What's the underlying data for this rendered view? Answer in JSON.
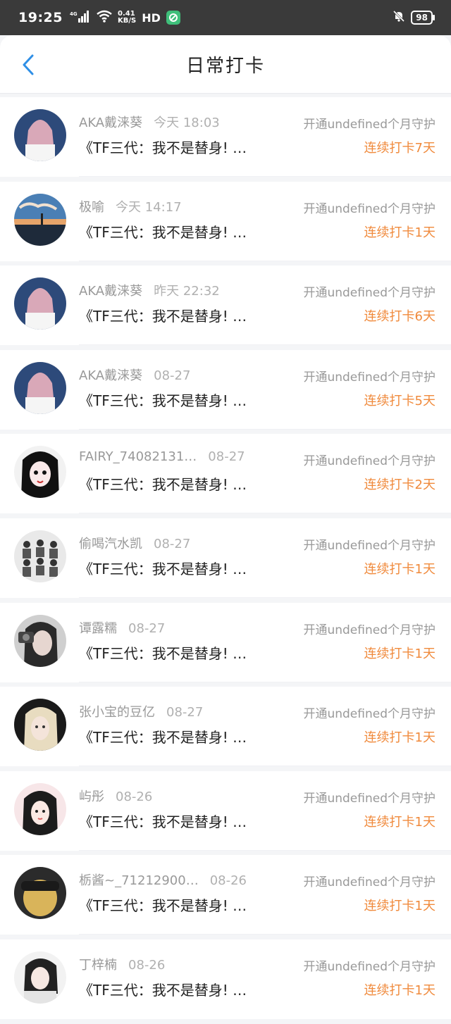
{
  "status_bar": {
    "time": "19:25",
    "network": "4G",
    "speed_top": "0.41",
    "speed_bottom": "KB/S",
    "hd": "HD",
    "battery": "98"
  },
  "header": {
    "title": "日常打卡"
  },
  "colors": {
    "accent": "#f08a3c",
    "back": "#2f8fe6"
  },
  "rows": [
    {
      "name": "AKA戴涞葵",
      "time": "今天 18:03",
      "title": "《TF三代：我不是替身! …",
      "right_top": "开通undefined个月守护",
      "right_bottom": "连续打卡7天"
    },
    {
      "name": "极喻",
      "time": "今天 14:17",
      "title": "《TF三代：我不是替身! …",
      "right_top": "开通undefined个月守护",
      "right_bottom": "连续打卡1天"
    },
    {
      "name": "AKA戴涞葵",
      "time": "昨天 22:32",
      "title": "《TF三代：我不是替身! …",
      "right_top": "开通undefined个月守护",
      "right_bottom": "连续打卡6天"
    },
    {
      "name": "AKA戴涞葵",
      "time": "08-27",
      "title": "《TF三代：我不是替身! …",
      "right_top": "开通undefined个月守护",
      "right_bottom": "连续打卡5天"
    },
    {
      "name": "FAIRY_74082131…",
      "time": "08-27",
      "title": "《TF三代：我不是替身! …",
      "right_top": "开通undefined个月守护",
      "right_bottom": "连续打卡2天"
    },
    {
      "name": "偷喝汽水凯",
      "time": "08-27",
      "title": "《TF三代：我不是替身! …",
      "right_top": "开通undefined个月守护",
      "right_bottom": "连续打卡1天"
    },
    {
      "name": "谭露糯",
      "time": "08-27",
      "title": "《TF三代：我不是替身! …",
      "right_top": "开通undefined个月守护",
      "right_bottom": "连续打卡1天"
    },
    {
      "name": "张小宝的豆亿",
      "time": "08-27",
      "title": "《TF三代：我不是替身! …",
      "right_top": "开通undefined个月守护",
      "right_bottom": "连续打卡1天"
    },
    {
      "name": "屿彤",
      "time": "08-26",
      "title": "《TF三代：我不是替身! …",
      "right_top": "开通undefined个月守护",
      "right_bottom": "连续打卡1天"
    },
    {
      "name": "栃酱~_71212900…",
      "time": "08-26",
      "title": "《TF三代：我不是替身! …",
      "right_top": "开通undefined个月守护",
      "right_bottom": "连续打卡1天"
    },
    {
      "name": "丁梓楠",
      "time": "08-26",
      "title": "《TF三代：我不是替身! …",
      "right_top": "开通undefined个月守护",
      "right_bottom": "连续打卡1天"
    }
  ]
}
